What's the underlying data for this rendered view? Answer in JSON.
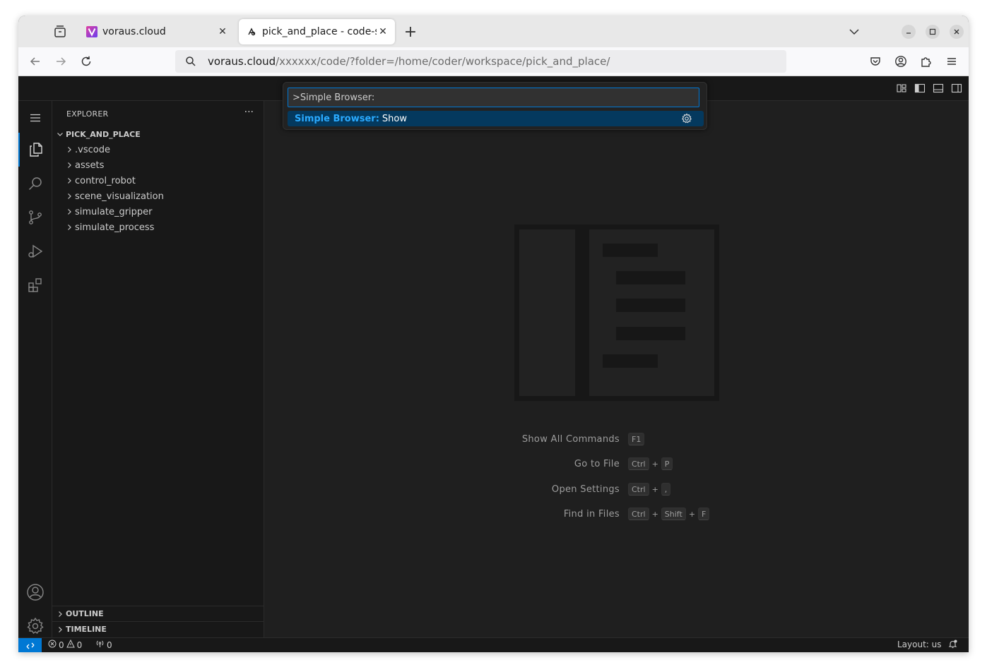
{
  "browser": {
    "tabs": [
      {
        "title": "voraus.cloud",
        "favicon": "voraus-v-icon"
      },
      {
        "title": "pick_and_place - code-ser",
        "favicon": "code-server-icon"
      }
    ],
    "url_host": "voraus.cloud",
    "url_path": "/xxxxxx/code/?folder=/home/coder/workspace/pick_and_place/"
  },
  "palette": {
    "input_value": ">Simple Browser:",
    "result_category": "Simple Browser:",
    "result_name": "Show"
  },
  "explorer": {
    "title": "EXPLORER",
    "more": "···",
    "root": "PICK_AND_PLACE",
    "folders": [
      ".vscode",
      "assets",
      "control_robot",
      "scene_visualization",
      "simulate_gripper",
      "simulate_process"
    ],
    "outline": "OUTLINE",
    "timeline": "TIMELINE"
  },
  "shortcuts": [
    {
      "label": "Show All Commands",
      "keys": [
        "F1"
      ]
    },
    {
      "label": "Go to File",
      "keys": [
        "Ctrl",
        "P"
      ]
    },
    {
      "label": "Open Settings",
      "keys": [
        "Ctrl",
        ","
      ]
    },
    {
      "label": "Find in Files",
      "keys": [
        "Ctrl",
        "Shift",
        "F"
      ]
    }
  ],
  "statusbar": {
    "errors": "0",
    "warnings": "0",
    "ports": "0",
    "layout": "Layout: us"
  },
  "colors": {
    "accent": "#0078d4",
    "palette_highlight": "#2aaaff",
    "editor_bg": "#1f1f1f"
  }
}
